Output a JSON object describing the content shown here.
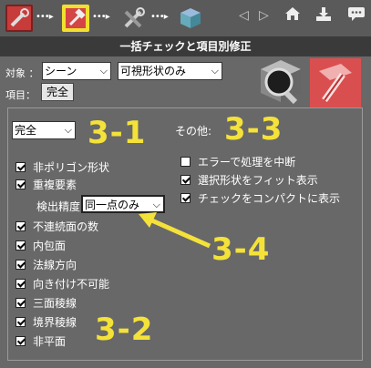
{
  "toolbar": {
    "icons": [
      "wrench-icon",
      "hammer-icon",
      "tools-icon",
      "cube-icon"
    ],
    "right_icons": [
      "triangle-left-icon",
      "triangle-right-icon",
      "home-icon",
      "download-icon",
      "comment-icon"
    ]
  },
  "title": "一括チェックと項目別修正",
  "target": {
    "label": "対象 ：",
    "scope_value": "シーン",
    "filter_value": "可視形状のみ"
  },
  "item": {
    "label": "項目：",
    "button_label": "完全"
  },
  "panel": {
    "preset_value": "完全",
    "other_label": "その他:",
    "checks": [
      {
        "label": "非ポリゴン形状",
        "checked": true
      },
      {
        "label": "重複要素",
        "checked": true
      },
      {
        "label": "不連続面の数",
        "checked": true
      },
      {
        "label": "内包面",
        "checked": true
      },
      {
        "label": "法線方向",
        "checked": true
      },
      {
        "label": "向き付け不可能",
        "checked": true
      },
      {
        "label": "三面稜線",
        "checked": true
      },
      {
        "label": "境界稜線",
        "checked": true
      },
      {
        "label": "非平面",
        "checked": true
      }
    ],
    "precision_label": "検出精度:",
    "precision_value": "同一点のみ",
    "other_checks": [
      {
        "label": "エラーで処理を中断",
        "checked": false
      },
      {
        "label": "選択形状をフィット表示",
        "checked": true
      },
      {
        "label": "チェックをコンパクトに表示",
        "checked": true
      }
    ]
  },
  "annotations": {
    "a31": "3-1",
    "a32": "3-2",
    "a33": "3-3",
    "a34": "3-4"
  },
  "colors": {
    "annotation": "#f4e23a",
    "background": "#686868",
    "title_bar": "#3a3a3a"
  }
}
